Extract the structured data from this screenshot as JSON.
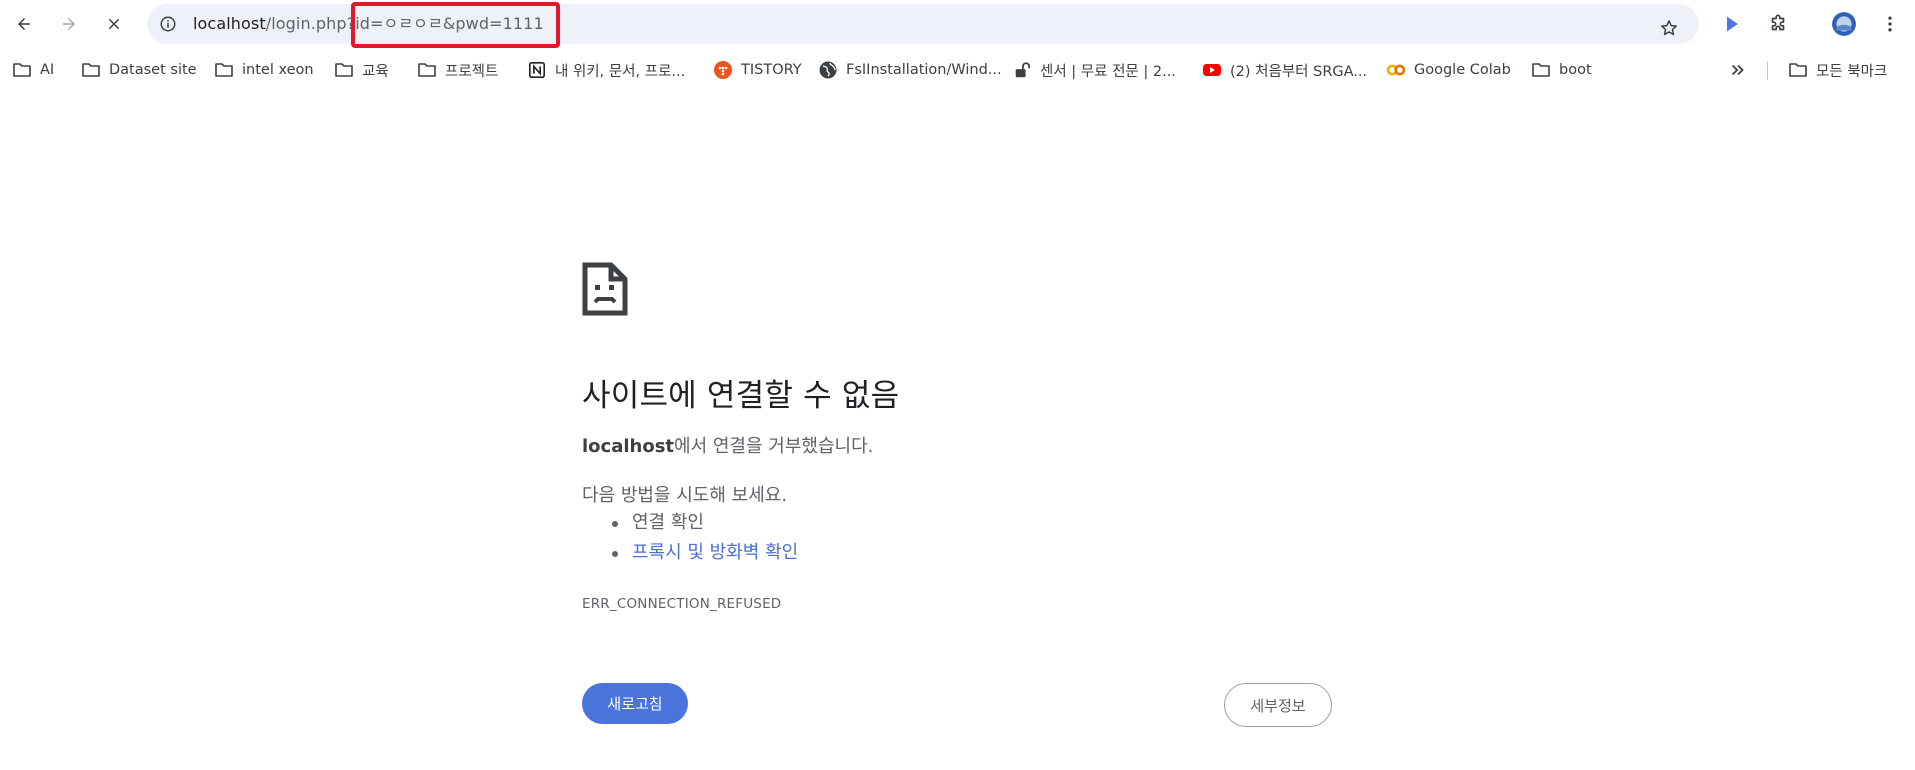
{
  "toolbar": {
    "url_host": "localhost",
    "url_path": "/login.php?id=ㅇㄹㅇㄹ&pwd=1111"
  },
  "bookmarks": [
    {
      "label": "AI",
      "icon": "folder-icon"
    },
    {
      "label": "Dataset site",
      "icon": "folder-icon"
    },
    {
      "label": "intel xeon",
      "icon": "folder-icon"
    },
    {
      "label": "교육",
      "icon": "folder-icon"
    },
    {
      "label": "프로젝트",
      "icon": "folder-icon"
    },
    {
      "label": "내 위키, 문서, 프로...",
      "icon": "notion-icon"
    },
    {
      "label": "TISTORY",
      "icon": "tistory-icon"
    },
    {
      "label": "FsIInstallation/Wind...",
      "icon": "globe-icon"
    },
    {
      "label": "센서 | 무료 전문 | 2...",
      "icon": "lock-open-icon"
    },
    {
      "label": "(2) 처음부터 SRGA...",
      "icon": "youtube-icon"
    },
    {
      "label": "Google Colab",
      "icon": "colab-icon"
    },
    {
      "label": "boot",
      "icon": "folder-icon"
    }
  ],
  "all_bookmarks_label": "모든 북마크",
  "error": {
    "title": "사이트에 연결할 수 없음",
    "host": "localhost",
    "desc_suffix": "에서 연결을 거부했습니다.",
    "try_label": "다음 방법을 시도해 보세요.",
    "suggestion_1": "연결 확인",
    "suggestion_2": "프록시 및 방화벽 확인",
    "code": "ERR_CONNECTION_REFUSED"
  },
  "buttons": {
    "reload": "새로고침",
    "details": "세부정보"
  },
  "colors": {
    "accent": "#4a73dc",
    "highlight": "#e0182c",
    "link": "#4a6fd8"
  }
}
